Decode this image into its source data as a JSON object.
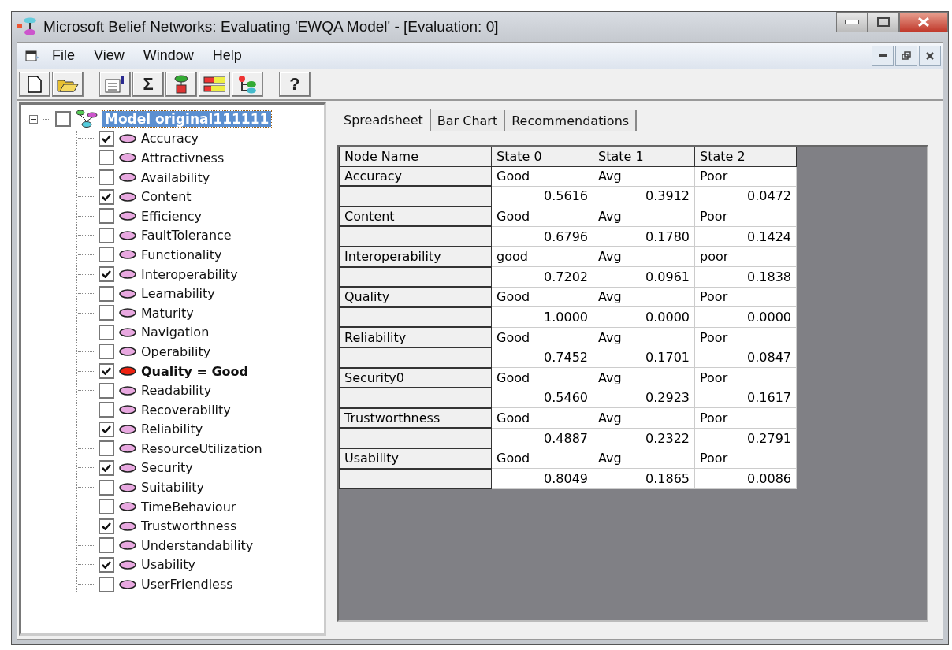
{
  "window": {
    "title": "Microsoft Belief Networks: Evaluating 'EWQA Model' - [Evaluation: 0]"
  },
  "menu": [
    "File",
    "View",
    "Window",
    "Help"
  ],
  "toolbar": [
    {
      "kind": "new"
    },
    {
      "kind": "open"
    },
    {
      "kind": "properties"
    },
    {
      "kind": "glyph",
      "glyph": "Σ"
    },
    {
      "kind": "node"
    },
    {
      "kind": "bars"
    },
    {
      "kind": "tree"
    },
    {
      "kind": "glyph",
      "glyph": "?"
    }
  ],
  "tree": {
    "label": "Model original111111",
    "checked": false,
    "selected": true,
    "expanded": true,
    "children": [
      {
        "label": "Accuracy",
        "checked": true,
        "evidence": false
      },
      {
        "label": "Attractivness",
        "checked": false,
        "evidence": false
      },
      {
        "label": "Availability",
        "checked": false,
        "evidence": false
      },
      {
        "label": "Content",
        "checked": true,
        "evidence": false
      },
      {
        "label": "Efficiency",
        "checked": false,
        "evidence": false
      },
      {
        "label": "FaultTolerance",
        "checked": false,
        "evidence": false
      },
      {
        "label": "Functionality",
        "checked": false,
        "evidence": false
      },
      {
        "label": "Interoperability",
        "checked": true,
        "evidence": false
      },
      {
        "label": "Learnability",
        "checked": false,
        "evidence": false
      },
      {
        "label": "Maturity",
        "checked": false,
        "evidence": false
      },
      {
        "label": "Navigation",
        "checked": false,
        "evidence": false
      },
      {
        "label": "Operability",
        "checked": false,
        "evidence": false
      },
      {
        "label": "Quality = Good",
        "checked": true,
        "evidence": true
      },
      {
        "label": "Readability",
        "checked": false,
        "evidence": false
      },
      {
        "label": "Recoverability",
        "checked": false,
        "evidence": false
      },
      {
        "label": "Reliability",
        "checked": true,
        "evidence": false
      },
      {
        "label": "ResourceUtilization",
        "checked": false,
        "evidence": false
      },
      {
        "label": "Security",
        "checked": true,
        "evidence": false
      },
      {
        "label": "Suitability",
        "checked": false,
        "evidence": false
      },
      {
        "label": "TimeBehaviour",
        "checked": false,
        "evidence": false
      },
      {
        "label": "Trustworthness",
        "checked": true,
        "evidence": false
      },
      {
        "label": "Understandability",
        "checked": false,
        "evidence": false
      },
      {
        "label": "Usability",
        "checked": true,
        "evidence": false
      },
      {
        "label": "UserFriendless",
        "checked": false,
        "evidence": false
      }
    ]
  },
  "tabs": [
    {
      "label": "Spreadsheet",
      "selected": true
    },
    {
      "label": "Bar Chart",
      "selected": false
    },
    {
      "label": "Recommendations",
      "selected": false
    }
  ],
  "table": {
    "columns": [
      "Node Name",
      "State 0",
      "State 1",
      "State 2"
    ],
    "rows": [
      {
        "node": "Accuracy",
        "states": [
          "Good",
          "Avg",
          "Poor"
        ],
        "values": [
          "0.5616",
          "0.3912",
          "0.0472"
        ]
      },
      {
        "node": "Content",
        "states": [
          "Good",
          "Avg",
          "Poor"
        ],
        "values": [
          "0.6796",
          "0.1780",
          "0.1424"
        ]
      },
      {
        "node": "Interoperability",
        "states": [
          "good",
          "Avg",
          "poor"
        ],
        "values": [
          "0.7202",
          "0.0961",
          "0.1838"
        ]
      },
      {
        "node": "Quality",
        "states": [
          "Good",
          "Avg",
          "Poor"
        ],
        "values": [
          "1.0000",
          "0.0000",
          "0.0000"
        ]
      },
      {
        "node": "Reliability",
        "states": [
          "Good",
          "Avg",
          "Poor"
        ],
        "values": [
          "0.7452",
          "0.1701",
          "0.0847"
        ]
      },
      {
        "node": "Security0",
        "states": [
          "Good",
          "Avg",
          "Poor"
        ],
        "values": [
          "0.5460",
          "0.2923",
          "0.1617"
        ]
      },
      {
        "node": "Trustworthness",
        "states": [
          "Good",
          "Avg",
          "Poor"
        ],
        "values": [
          "0.4887",
          "0.2322",
          "0.2791"
        ]
      },
      {
        "node": "Usability",
        "states": [
          "Good",
          "Avg",
          "Poor"
        ],
        "values": [
          "0.8049",
          "0.1865",
          "0.0086"
        ]
      }
    ]
  }
}
